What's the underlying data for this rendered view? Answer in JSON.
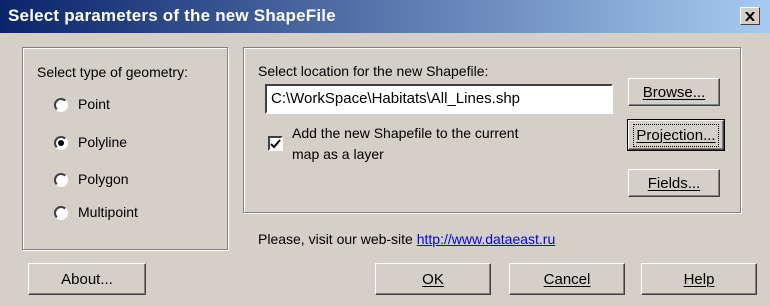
{
  "window": {
    "title": "Select parameters of the new ShapeFile"
  },
  "geometry": {
    "heading": "Select type of geometry:",
    "options": [
      {
        "label": "Point",
        "selected": false
      },
      {
        "label": "Polyline",
        "selected": true
      },
      {
        "label": "Polygon",
        "selected": false
      },
      {
        "label": "Multipoint",
        "selected": false
      }
    ]
  },
  "location": {
    "heading": "Select location for the new Shapefile:",
    "path": "C:\\WorkSpace\\Habitats\\All_Lines.shp",
    "add_to_map": {
      "checked": true,
      "line1": "Add the new Shapefile to the current",
      "line2": "map as a layer"
    }
  },
  "buttons": {
    "browse": "Browse...",
    "projection": "Projection...",
    "fields": "Fields...",
    "about": "About...",
    "ok": "OK",
    "cancel": "Cancel",
    "help": "Help"
  },
  "footer": {
    "visit_text": "Please, visit our web-site",
    "url": "http://www.dataeast.ru"
  }
}
